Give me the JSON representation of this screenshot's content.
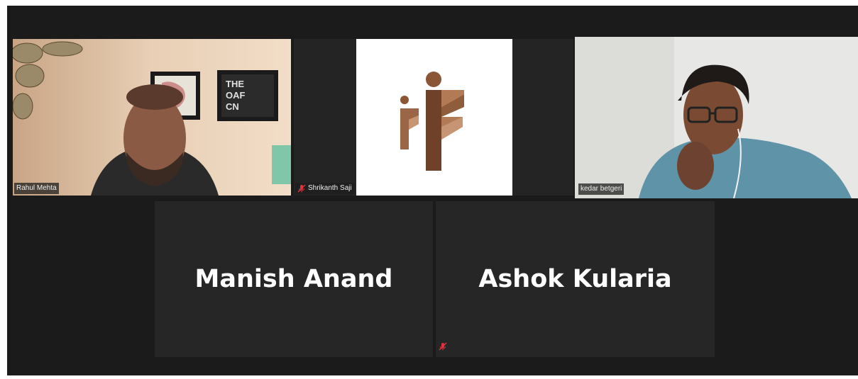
{
  "participants": [
    {
      "name": "Rahul Mehta",
      "video": true,
      "muted": false,
      "active": false
    },
    {
      "name": "Shrikanth Saji",
      "video": "logo",
      "muted": true,
      "active": false
    },
    {
      "name": "kedar betgeri",
      "video": true,
      "muted": false,
      "active": true
    },
    {
      "name": "Manish Anand",
      "video": false,
      "muted": false,
      "active": false
    },
    {
      "name": "Ashok Kularia",
      "video": false,
      "muted": true,
      "active": false
    }
  ],
  "colors": {
    "background": "#1b1b1b",
    "tile": "#262626",
    "active_speaker_border": "#c5dc4b",
    "mute_icon": "#e0333b",
    "logo_brown_dark": "#7a4a30",
    "logo_brown_light": "#b07a55"
  },
  "icons": [
    "muted-mic-icon"
  ]
}
